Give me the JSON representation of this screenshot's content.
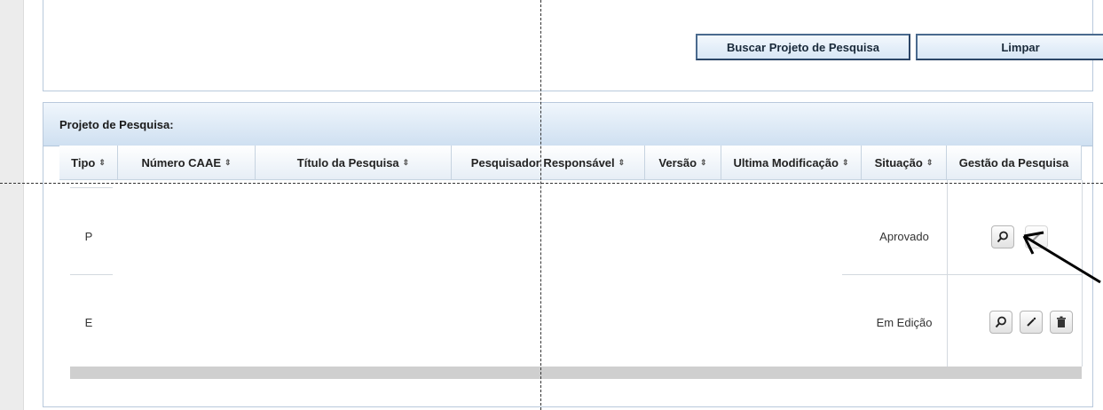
{
  "buttons": {
    "search_label": "Buscar Projeto de Pesquisa",
    "clear_label": "Limpar"
  },
  "results": {
    "title": "Projeto de Pesquisa:",
    "columns": [
      {
        "label": "Tipo",
        "sortable": true
      },
      {
        "label": "Número CAAE",
        "sortable": true
      },
      {
        "label": "Título da Pesquisa",
        "sortable": true
      },
      {
        "label": "Pesquisador Responsável",
        "sortable": true
      },
      {
        "label": "Versão",
        "sortable": true
      },
      {
        "label": "Ultima Modificação",
        "sortable": true
      },
      {
        "label": "Situação",
        "sortable": true
      },
      {
        "label": "Gestão da Pesquisa",
        "sortable": false
      }
    ],
    "sort_glyph": "⇕",
    "rows": [
      {
        "tipo": "P",
        "situacao": "Aprovado",
        "actions": [
          "search-icon",
          "edit-icon-disabled"
        ]
      },
      {
        "tipo": "E",
        "situacao": "Em Edição",
        "actions": [
          "search-icon",
          "edit-icon",
          "trash-icon"
        ]
      }
    ]
  },
  "colors": {
    "header_blue": "#cfe0f1",
    "button_border": "#4a6a8e",
    "panel_border": "#b9c9dc"
  }
}
